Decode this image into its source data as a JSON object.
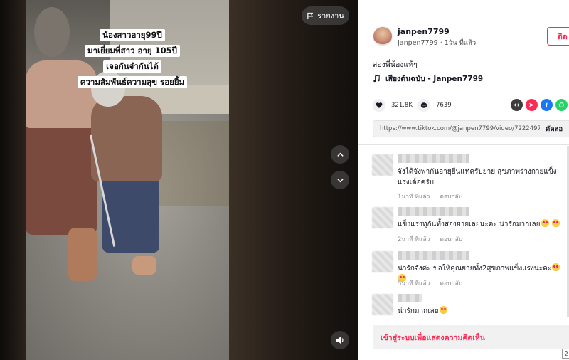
{
  "video": {
    "caption_lines": [
      "น้องสาวอายุ99ปี",
      "มาเยี่ยมพี่สาว อายุ 105ปี",
      "เจอกันจำกันได้",
      "ความสัมพันธ์ความสุข รอยยิ้ม"
    ],
    "report_label": "รายงาน",
    "icons": {
      "report": "flag-icon",
      "prev": "chevron-up-icon",
      "next": "chevron-down-icon",
      "volume": "volume-icon"
    }
  },
  "author": {
    "username": "janpen7799",
    "subline": "Janpen7799 · 1วัน ที่แล้ว",
    "follow_label": "ติด"
  },
  "post": {
    "description": "สองพี่น้องแท้ๆ",
    "music": "เสียงต้นฉบับ - Janpen7799"
  },
  "stats": {
    "likes": "321.8K",
    "comments": "7639"
  },
  "share": {
    "icons": [
      "embed-icon",
      "send-icon",
      "facebook-icon",
      "whatsapp-icon"
    ]
  },
  "link": {
    "url": "https://www.tiktok.com/@janpen7799/video/722249768...",
    "copy_label": "คัดลอ"
  },
  "comments": [
    {
      "text": "จังได้จังพากันอายุยืนแท่ครับยาย สุขภาพร่างกายแข็งแรงเด้อครับ",
      "time": "1นาที ที่แล้ว",
      "reply": "ตอบกลับ",
      "emojis": 0
    },
    {
      "text": "แข็งแรงทุกันทั้งสองยายเลยนะคะ น่ารักมากเลย",
      "time": "2นาที ที่แล้ว",
      "reply": "ตอบกลับ",
      "emojis": 2
    },
    {
      "text": "น่ารักจังค่ะ ขอให้คุณยายทั้ง2สุขภาพแข็งแรงนะคะ",
      "time": "5นาที ที่แล้ว",
      "reply": "ตอบกลับ",
      "emojis": 2
    },
    {
      "text": "น่ารักมากเลย",
      "time": "",
      "reply": "",
      "emojis": 1
    }
  ],
  "login_prompt": "เข้าสู่ระบบเพื่อแสดงความคิดเห็น",
  "page_badge": "2",
  "colors": {
    "accent": "#fe2c55",
    "facebook": "#1877f2",
    "whatsapp": "#25d366"
  }
}
